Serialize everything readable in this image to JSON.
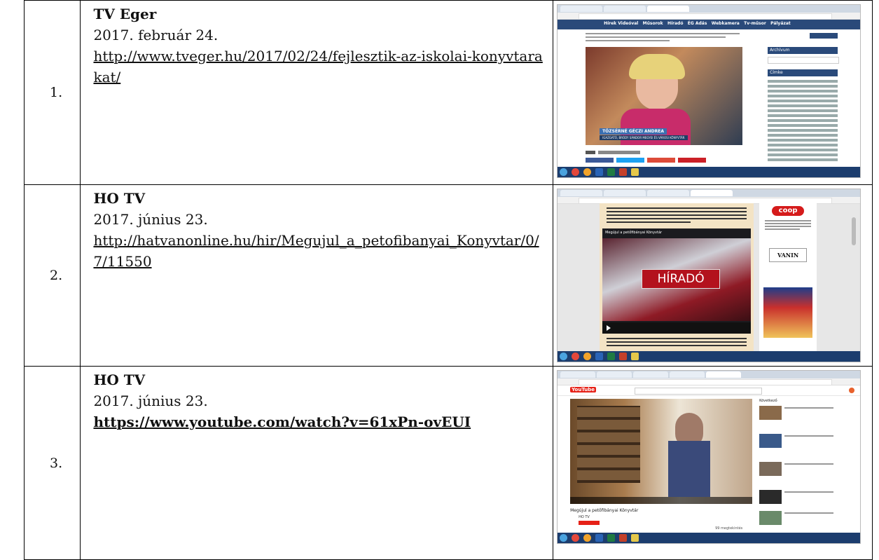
{
  "rows": [
    {
      "number": "1.",
      "source": "TV Eger",
      "date": "2017. február 24.",
      "url": "http://www.tveger.hu/2017/02/24/fejlesztik-az-iskolai-konyvtarakat/",
      "thumb": {
        "nav_items": [
          "Hírek Videóval",
          "Műsorok",
          "Híradó",
          "ÉG Adás",
          "Webkamera",
          "Tv-műsor",
          "Pályázat"
        ],
        "sidebar_heading_1": "Archívum",
        "sidebar_heading_2": "Címke",
        "caption_name": "TÖZSÉRNÉ GÉCZI ANDREA",
        "caption_role": "IGAZGATÓ, BRÓDY SÁNDOR MEGYEI ÉS VÁROSI KÖNYVTÁR"
      }
    },
    {
      "number": "2.",
      "source": "HO TV",
      "date": "2017. június 23.",
      "url": "http://hatvanonline.hu/hir/Megujul_a_petofibanyai_Konyvtar/0/7/11550",
      "thumb": {
        "video_title": "Megújul a petőfibányai Könyvtár",
        "overlay": "HÍRADÓ",
        "ad_logo": "coop",
        "ad_vanin": "VANIN"
      }
    },
    {
      "number": "3.",
      "source": "HO TV",
      "date": "2017. június 23.",
      "url": "https://www.youtube.com/watch?v=61xPn-ovEUI",
      "thumb": {
        "logo": "YouTube",
        "video_title": "Megújul a petőfibányai Könyvtár",
        "channel": "HO TV",
        "views": "99 megtekintés",
        "up_next": "Következő"
      }
    }
  ],
  "colors": {
    "tveger_nav": "#2a4a7a",
    "hatvan_bg": "#f3e3c4",
    "coop_red": "#d51b1b",
    "youtube_red": "#e62117",
    "taskbar": "#1c3d6e"
  }
}
